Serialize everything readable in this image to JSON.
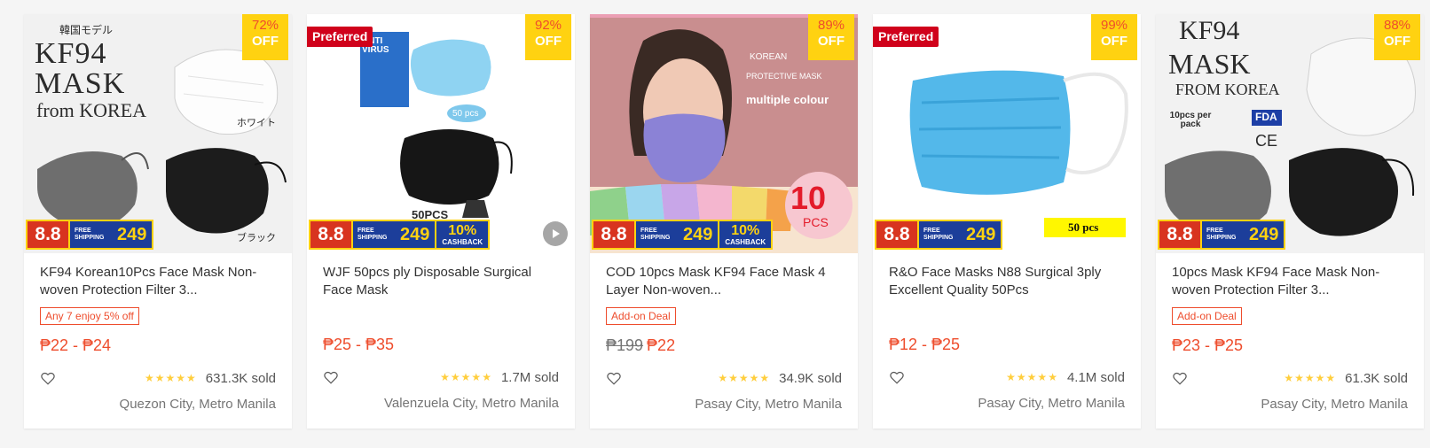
{
  "colors": {
    "price": "#ee4d2d",
    "discount_bg": "#ffd211",
    "preferred_bg": "#d0011b",
    "promo_blue": "#1c3e9a",
    "promo_red": "#d8341f",
    "stars": "#ffce3d"
  },
  "promo": {
    "day": "8.8",
    "free_shipping": "FREE SHIPPING",
    "free_shipping_amount": "249",
    "cashback_pct": "10%",
    "cashback_label": "CASHBACK"
  },
  "products": [
    {
      "discount_pct": "72%",
      "discount_off": "OFF",
      "preferred": "",
      "img": {
        "line1": "韓国モデル",
        "line2": "KF94",
        "line3": "MASK",
        "line4": "from KOREA",
        "jp_white": "ホワイト",
        "jp_black": "ブラック"
      },
      "name": "KF94 Korean10Pcs Face Mask Non-woven Protection Filter 3...",
      "tag": "Any 7 enjoy 5% off",
      "old_price": "",
      "price": "₱22 - ₱24",
      "stars": "★★★★★",
      "sold": "631.3K sold",
      "location": "Quezon City, Metro Manila",
      "cashback": false
    },
    {
      "discount_pct": "92%",
      "discount_off": "OFF",
      "preferred": "Preferred",
      "img": {
        "virus": "ANTI VIRUS",
        "count": "50 pcs",
        "pcs": "50PCS"
      },
      "name": "WJF 50pcs ply Disposable Surgical Face Mask",
      "tag": "",
      "old_price": "",
      "price": "₱25 - ₱35",
      "stars": "★★★★★",
      "sold": "1.7M sold",
      "location": "Valenzuela City, Metro Manila",
      "cashback": true
    },
    {
      "discount_pct": "89%",
      "discount_off": "OFF",
      "preferred": "",
      "img": {
        "korean": "KOREAN",
        "protective": "PROTECTIVE MASK",
        "colour": "multiple colour",
        "ten": "10",
        "pcs": "PCS"
      },
      "name": "COD 10pcs Mask KF94 Face Mask 4 Layer Non-woven...",
      "tag": "Add-on Deal",
      "old_price": "₱199",
      "price": "₱22",
      "stars": "★★★★★",
      "sold": "34.9K sold",
      "location": "Pasay City, Metro Manila",
      "cashback": true
    },
    {
      "discount_pct": "99%",
      "discount_off": "OFF",
      "preferred": "Preferred",
      "img": {
        "pcs": "50 pcs"
      },
      "name": "R&O Face Masks N88 Surgical 3ply Excellent Quality 50Pcs",
      "tag": "",
      "old_price": "",
      "price": "₱12 - ₱25",
      "stars": "★★★★★",
      "sold": "4.1M sold",
      "location": "Pasay City, Metro Manila",
      "cashback": false
    },
    {
      "discount_pct": "88%",
      "discount_off": "OFF",
      "preferred": "",
      "img": {
        "line2": "KF94",
        "line3": "MASK",
        "line4": "FROM KOREA",
        "pack": "10pcs per pack",
        "fda": "FDA",
        "ce": "CE"
      },
      "name": "10pcs Mask KF94 Face Mask Non-woven Protection Filter 3...",
      "tag": "Add-on Deal",
      "old_price": "",
      "price": "₱23 - ₱25",
      "stars": "★★★★★",
      "sold": "61.3K sold",
      "location": "Pasay City, Metro Manila",
      "cashback": false
    }
  ]
}
